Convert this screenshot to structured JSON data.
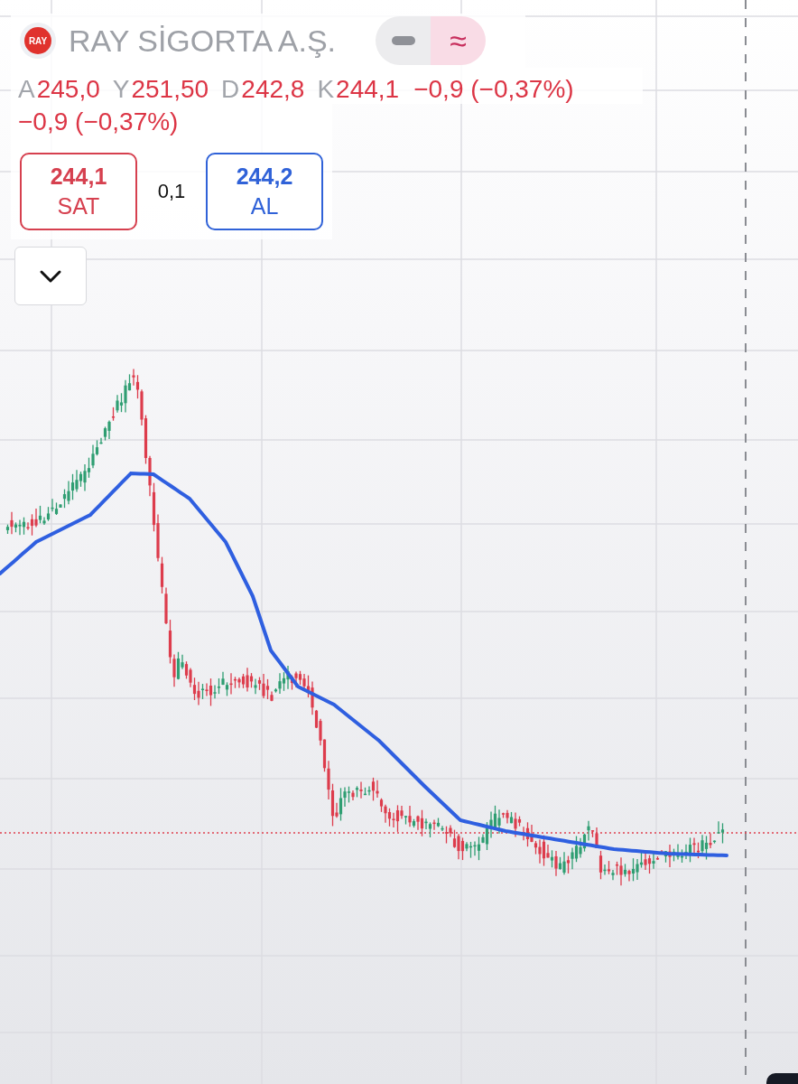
{
  "header": {
    "logo_text": "RAY",
    "title": "RAY SİGORTA A.Ş.",
    "mode_toggle": [
      {
        "kind": "dash",
        "selected": false
      },
      {
        "kind": "glyph",
        "label": "≈",
        "selected": true
      }
    ]
  },
  "stats": [
    {
      "label": "A",
      "value": "245,0"
    },
    {
      "label": "Y",
      "value": "251,50"
    },
    {
      "label": "D",
      "value": "242,8"
    },
    {
      "label": "K",
      "value": "244,1"
    }
  ],
  "change": "−0,9 (−0,37%)",
  "change_repeat": "−0,9 (−0,37%)",
  "quote": {
    "sell": {
      "price": "244,1",
      "label": "SAT"
    },
    "spread": "0,1",
    "buy": {
      "price": "244,2",
      "label": "AL"
    }
  },
  "expand_button": {
    "expanded": false
  }
}
